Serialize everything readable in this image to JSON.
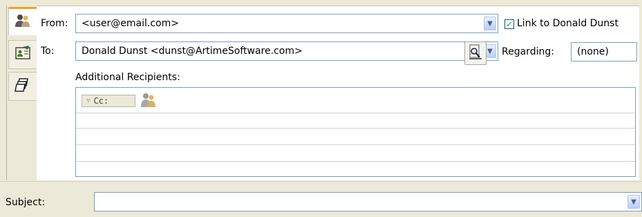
{
  "header": {
    "from_label": "From:",
    "from_value": "<user@email.com>",
    "to_label": "To:",
    "to_value": "Donald Dunst <dunst@ArtimeSoftware.com>",
    "link_label": "Link to Donald Dunst",
    "link_checked": true,
    "regarding_label": "Regarding:",
    "regarding_value": "(none)"
  },
  "recipients": {
    "label": "Additional Recipients:",
    "cc_label": "Cc:"
  },
  "subject": {
    "label": "Subject:",
    "value": ""
  },
  "icons": {
    "tab_people": "people-icon",
    "tab_contact_card": "contact-card-icon",
    "tab_copies": "copies-icon",
    "address_lookup": "magnifier-icon",
    "dropdown": "chevron-down-icon",
    "cc_person": "person-icon"
  },
  "colors": {
    "background": "#ece9d8",
    "panel": "#ffffff",
    "field_border": "#7f9db9",
    "active_tab_accent": "#f4a21c",
    "check": "#21a121"
  }
}
